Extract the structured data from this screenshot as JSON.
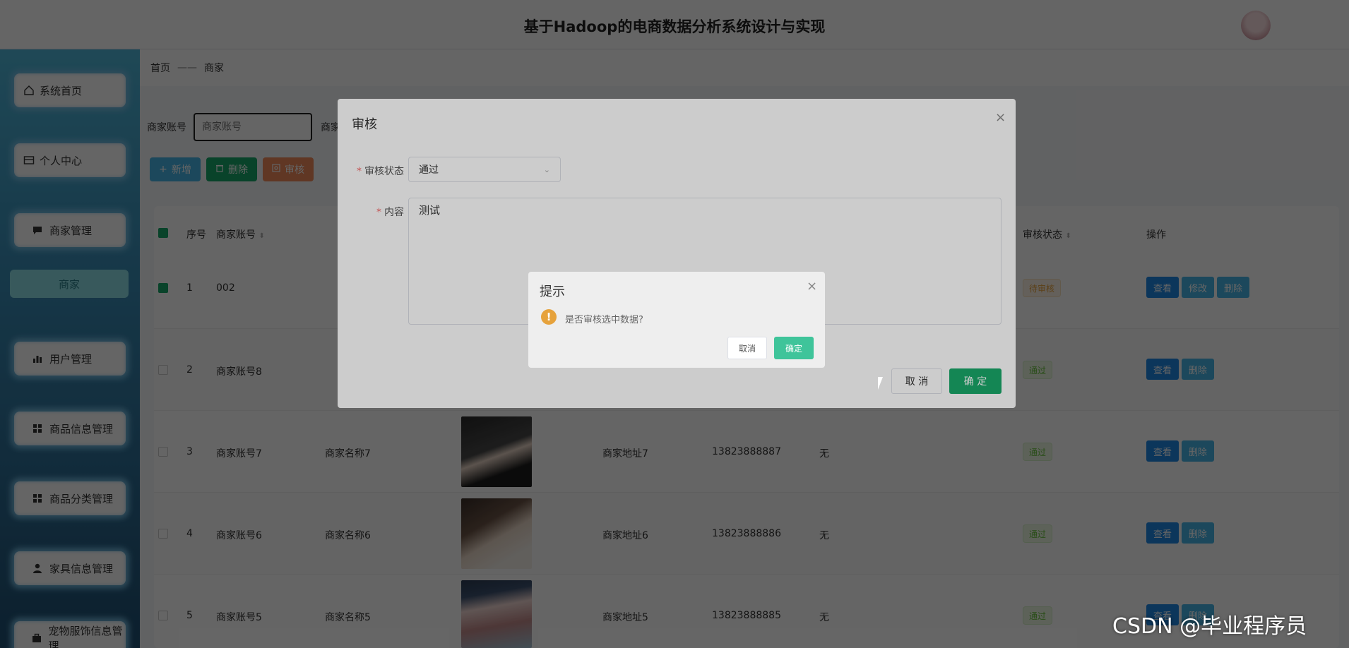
{
  "header": {
    "title": "基于Hadoop的电商数据分析系统设计与实现"
  },
  "sidebar": {
    "items": [
      {
        "label": "系统首页",
        "icon": "home-icon"
      },
      {
        "label": "个人中心",
        "icon": "card-icon"
      },
      {
        "label": "商家管理",
        "icon": "chat-icon"
      },
      {
        "label": "商家",
        "icon": ""
      },
      {
        "label": "用户管理",
        "icon": "bar-chart-icon"
      },
      {
        "label": "商品信息管理",
        "icon": "grid-icon"
      },
      {
        "label": "商品分类管理",
        "icon": "grid-icon"
      },
      {
        "label": "家具信息管理",
        "icon": "user-icon"
      },
      {
        "label": "宠物服饰信息管理",
        "icon": "briefcase-icon"
      }
    ]
  },
  "breadcrumb": {
    "home": "首页",
    "separator": "——",
    "current": "商家"
  },
  "search": {
    "label1": "商家账号",
    "placeholder1": "商家账号",
    "label2": "商家"
  },
  "toolbar": {
    "add": "新增",
    "delete": "删除",
    "review": "审核"
  },
  "table": {
    "headers": {
      "index": "序号",
      "account": "商家账号",
      "status": "审核状态",
      "actions": "操作"
    },
    "rows": [
      {
        "index": "1",
        "account": "002",
        "name": "",
        "address": "",
        "phone": "",
        "remark": "",
        "status": "待审核",
        "checked": true,
        "edit": "修改"
      },
      {
        "index": "2",
        "account": "商家账号8",
        "name": "",
        "address": "",
        "phone": "",
        "remark": "",
        "status": "通过",
        "checked": false
      },
      {
        "index": "3",
        "account": "商家账号7",
        "name": "商家名称7",
        "address": "商家地址7",
        "phone": "13823888887",
        "remark": "无",
        "status": "通过",
        "checked": false
      },
      {
        "index": "4",
        "account": "商家账号6",
        "name": "商家名称6",
        "address": "商家地址6",
        "phone": "13823888886",
        "remark": "无",
        "status": "通过",
        "checked": false
      },
      {
        "index": "5",
        "account": "商家账号5",
        "name": "商家名称5",
        "address": "商家地址5",
        "phone": "13823888885",
        "remark": "无",
        "status": "通过",
        "checked": false
      }
    ],
    "actions": {
      "view": "查看",
      "edit": "修改",
      "delete": "删除"
    }
  },
  "review_dialog": {
    "title": "审核",
    "status_label": "审核状态",
    "status_value": "通过",
    "content_label": "内容",
    "content_value": "测试",
    "cancel": "取 消",
    "confirm": "确 定"
  },
  "confirm_dialog": {
    "title": "提示",
    "message": "是否审核选中数据?",
    "cancel": "取消",
    "confirm": "确定"
  },
  "watermark": "CSDN @毕业程序员",
  "colors": {
    "primary": "#19a86a",
    "add": "#49b7e6",
    "review": "#f08a5d",
    "view": "#1e88e5",
    "edit": "#49b7e6"
  }
}
